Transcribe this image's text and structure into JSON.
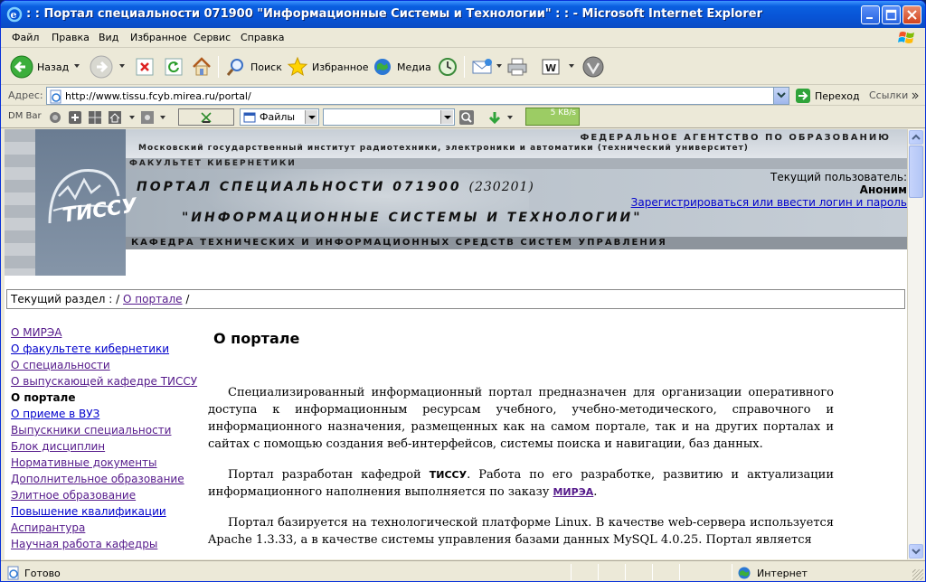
{
  "window": {
    "title": ": : Портал специальности 071900 \"Информационные Системы и Технологии\" : : - Microsoft Internet Explorer"
  },
  "menu": [
    "Файл",
    "Правка",
    "Вид",
    "Избранное",
    "Сервис",
    "Справка"
  ],
  "toolbar": {
    "back_label": "Назад",
    "search_label": "Поиск",
    "favorites_label": "Избранное",
    "media_label": "Медиа"
  },
  "address": {
    "label": "Адрес:",
    "url": "http://www.tissu.fcyb.mirea.ru/portal/",
    "go_label": "Переход",
    "links_label": "Ссылки"
  },
  "dmbar": {
    "label": "DM Bar",
    "files_label": "Файлы",
    "speed": "5 KB/s"
  },
  "banner": {
    "agency": "ФЕДЕРАЛЬНОЕ АГЕНТСТВО ПО ОБРАЗОВАНИЮ",
    "institute": "Московский государственный институт радиотехники, электроники и автоматики (технический университет)",
    "faculty": "ФАКУЛЬТЕТ КИБЕРНЕТИКИ",
    "portal_title": "ПОРТАЛ СПЕЦИАЛЬНОСТИ 071900",
    "portal_code": "(230201)",
    "portal_subtitle": "\"ИНФОРМАЦИОННЫЕ СИСТЕМЫ И ТЕХНОЛОГИИ\"",
    "department": "КАФЕДРА ТЕХНИЧЕСКИХ И ИНФОРМАЦИОННЫХ СРЕДСТВ СИСТЕМ УПРАВЛЕНИЯ",
    "logo_text": "ТИССУ",
    "user_label": "Текущий пользователь:",
    "user_name": "Аноним",
    "login_link": "Зарегистрироваться или ввести логин и пароль"
  },
  "breadcrumb": {
    "label": "Текущий раздел : /",
    "link": "О портале",
    "trail_end": "/"
  },
  "nav": [
    {
      "label": "О МИРЭА",
      "state": "visited"
    },
    {
      "label": "О факультете кибернетики",
      "state": "link"
    },
    {
      "label": "О специальности",
      "state": "visited"
    },
    {
      "label": "О выпускающей кафедре ТИССУ",
      "state": "visited"
    },
    {
      "label": "О портале",
      "state": "current"
    },
    {
      "label": "О приеме в ВУЗ",
      "state": "link"
    },
    {
      "label": "Выпускники специальности",
      "state": "visited"
    },
    {
      "label": "Блок дисциплин",
      "state": "visited"
    },
    {
      "label": "Нормативные документы",
      "state": "visited"
    },
    {
      "label": "Дополнительное образование",
      "state": "visited"
    },
    {
      "label": "Элитное образование",
      "state": "visited"
    },
    {
      "label": "Повышение квалификации",
      "state": "link"
    },
    {
      "label": "Аспирантура",
      "state": "visited"
    },
    {
      "label": "Научная работа кафедры",
      "state": "visited"
    }
  ],
  "content": {
    "heading": "О портале",
    "p1": "Специализированный информационный портал предназначен для организации оперативного доступа к информационным ресурсам учебного, учебно-методического, справочного и информационного назначения, размещенных как на самом портале, так и на других порталах и сайтах с помощью создания веб-интерфейсов, системы поиска и навигации, баз данных.",
    "p2_a": "Портал разработан кафедрой",
    "p2_b": "ТИССУ",
    "p2_c": ". Работа по его разработке, развитию и актуализации информационного наполнения выполняется по заказу",
    "p2_d": "МИРЭА",
    "p2_e": ".",
    "p3": "Портал базируется на технологической платформе Linux. В качестве web-сервера используется Apache 1.3.33, а в качестве системы управления базами данных MySQL 4.0.25. Портал является"
  },
  "status": {
    "text": "Готово",
    "zone": "Интернет"
  }
}
